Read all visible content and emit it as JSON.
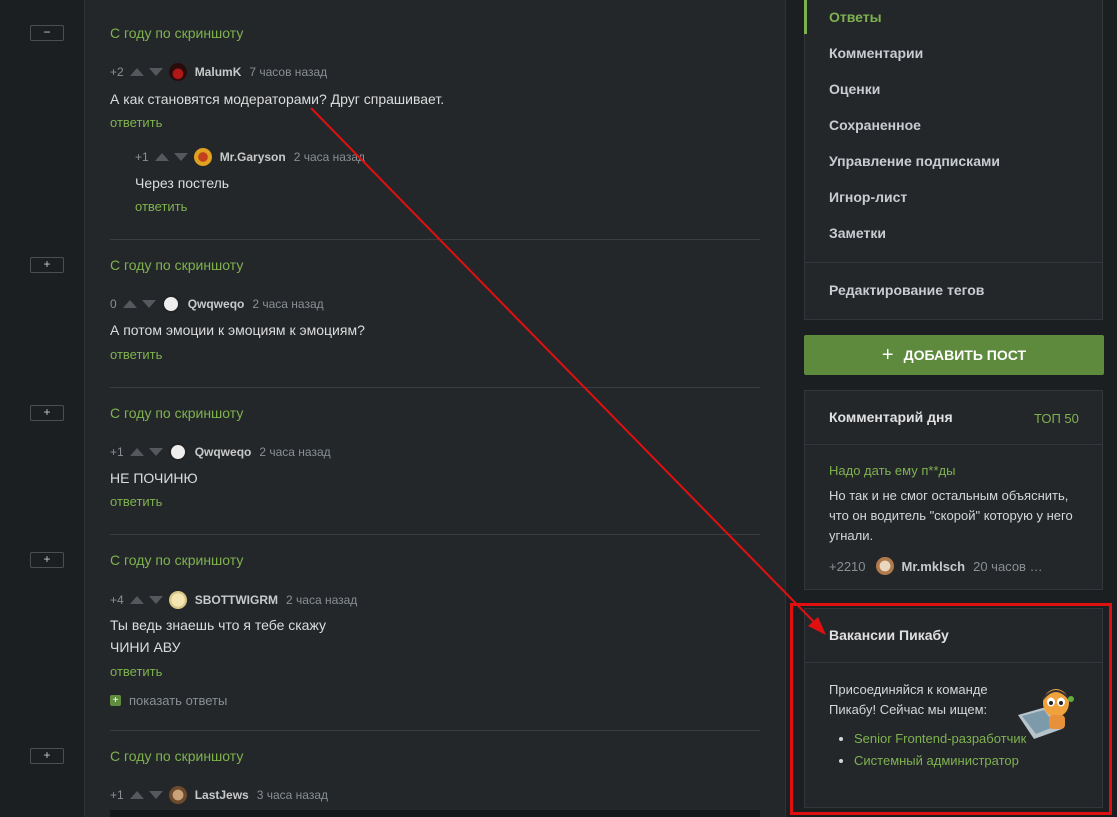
{
  "gutter": {
    "collapse_symbol": "−",
    "expand_symbol": "+"
  },
  "threads": [
    {
      "title": "С году по скриншоту",
      "comment": {
        "score": "+2",
        "author": "MalumK",
        "time": "7 часов назад",
        "text": "А как становятся модераторами? Друг спрашивает.",
        "reply": "ответить"
      },
      "child": {
        "score": "+1",
        "author": "Mr.Garyson",
        "time": "2 часа назад",
        "text": "Через постель",
        "reply": "ответить"
      }
    },
    {
      "title": "С году по скриншоту",
      "comment": {
        "score": "0",
        "author": "Qwqweqo",
        "time": "2 часа назад",
        "text": "А потом эмоции к эмоциям к эмоциям?",
        "reply": "ответить"
      }
    },
    {
      "title": "С году по скриншоту",
      "comment": {
        "score": "+1",
        "author": "Qwqweqo",
        "time": "2 часа назад",
        "text": "НЕ ПОЧИНЮ",
        "reply": "ответить"
      }
    },
    {
      "title": "С году по скриншоту",
      "comment": {
        "score": "+4",
        "author": "SBOTTWIGRM",
        "time": "2 часа назад",
        "text1": "Ты ведь знаешь что я тебе скажу",
        "text2": "ЧИНИ АВУ",
        "reply": "ответить"
      },
      "show_replies": "показать ответы"
    },
    {
      "title": "С году по скриншоту",
      "comment": {
        "score": "+1",
        "author": "LastJews",
        "time": "3 часа назад"
      }
    }
  ],
  "sidebar": {
    "menu": [
      "Ответы",
      "Комментарии",
      "Оценки",
      "Сохраненное",
      "Управление подписками",
      "Игнор-лист",
      "Заметки"
    ],
    "edit_tags": "Редактирование тегов",
    "add_post": "ДОБАВИТЬ ПОСТ",
    "comment_of_day": {
      "title": "Комментарий дня",
      "top": "ТОП 50",
      "post_title": "Надо дать ему п**ды",
      "text": "Но так и не смог остальным объяснить, что он водитель \"скорой\" которую у него угнали.",
      "score": "+2210",
      "author": "Mr.mklsch",
      "time": "20 часов …"
    },
    "vacancies": {
      "title": "Вакансии Пикабу",
      "text": "Присоединяйся к команде Пикабу! Сейчас мы ищем:",
      "jobs": [
        "Senior Frontend-разработчик",
        "Системный администратор"
      ]
    }
  },
  "colors": {
    "accent": "#7fb24f",
    "button": "#5d8a3c",
    "annotation": "#e01010"
  }
}
